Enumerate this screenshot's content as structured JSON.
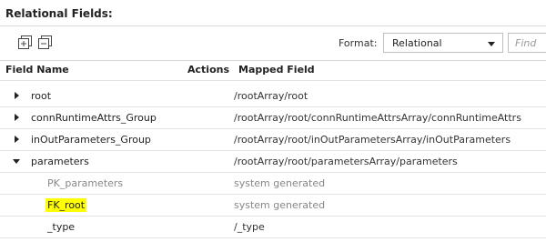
{
  "section_title": "Relational Fields:",
  "toolbar": {
    "expand_all_icon": "expand-all-icon",
    "collapse_all_icon": "collapse-all-icon",
    "format_label": "Format:",
    "format_value": "Relational",
    "find_placeholder": "Find"
  },
  "table": {
    "headers": [
      "Field Name",
      "Actions",
      "Mapped Field"
    ],
    "rows": [
      {
        "name": "root",
        "mapped": "/rootArray/root",
        "expander": "collapsed",
        "level": 0
      },
      {
        "name": "connRuntimeAttrs_Group",
        "mapped": "/rootArray/root/connRuntimeAttrsArray/connRuntimeAttrs",
        "expander": "collapsed",
        "level": 0
      },
      {
        "name": "inOutParameters_Group",
        "mapped": "/rootArray/root/inOutParametersArray/inOutParameters",
        "expander": "collapsed",
        "level": 0
      },
      {
        "name": "parameters",
        "mapped": "/rootArray/root/parametersArray/parameters",
        "expander": "expanded",
        "level": 0
      },
      {
        "name": "PK_parameters",
        "mapped": "system generated",
        "level": 1
      },
      {
        "name": "FK_root",
        "mapped": "system generated",
        "level": 1,
        "highlighted": true
      },
      {
        "name": "_type",
        "mapped": "/_type",
        "level": 1
      }
    ]
  },
  "colors": {
    "highlight": "#ffff00",
    "muted_text": "#888888",
    "border": "#d9d9d9"
  }
}
